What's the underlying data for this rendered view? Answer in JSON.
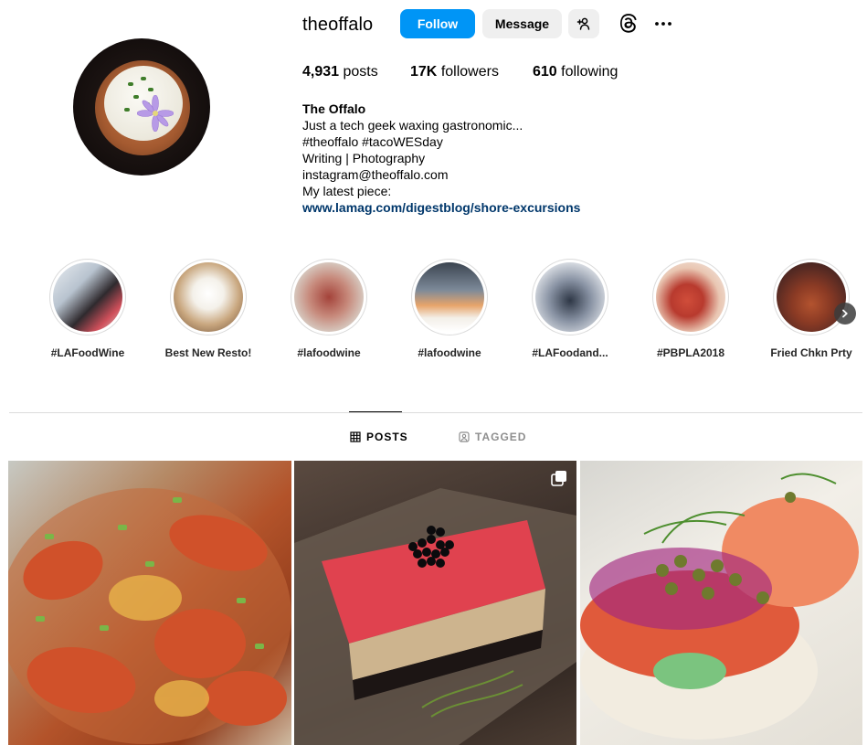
{
  "profile": {
    "username": "theoffalo",
    "follow_label": "Follow",
    "message_label": "Message",
    "stats": {
      "posts_count": "4,931",
      "posts_label": "posts",
      "followers_count": "17K",
      "followers_label": "followers",
      "following_count": "610",
      "following_label": "following"
    },
    "bio": {
      "name": "The Offalo",
      "lines": [
        "Just a tech geek waxing gastronomic...",
        "#theoffalo #tacoWESday",
        "Writing | Photography",
        "instagram@theoffalo.com",
        "My latest piece:"
      ],
      "link": "www.lamag.com/digestblog/shore-excursions"
    }
  },
  "highlights": [
    {
      "label": "#LAFoodWine"
    },
    {
      "label": "Best New Resto!"
    },
    {
      "label": "#lafoodwine"
    },
    {
      "label": "#lafoodwine"
    },
    {
      "label": "#LAFoodand..."
    },
    {
      "label": "#PBPLA2018"
    },
    {
      "label": "Fried Chkn Prty"
    }
  ],
  "tabs": {
    "posts": "POSTS",
    "tagged": "TAGGED"
  },
  "colors": {
    "follow_button": "#0095f6",
    "secondary_button": "#efefef",
    "link": "#00376b",
    "divider": "#dbdbdb"
  }
}
